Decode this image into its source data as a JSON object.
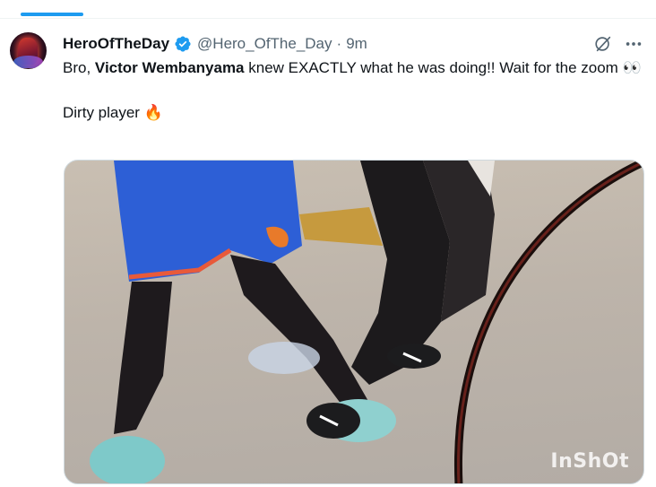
{
  "tweet": {
    "display_name": "HeroOfTheDay",
    "handle": "@Hero_OfThe_Day",
    "separator": "·",
    "time": "9m",
    "text_before_bold": "Bro, ",
    "text_bold": "Victor Wembanyama",
    "text_after_bold": " knew EXACTLY what he was doing!! Wait for the zoom 👀",
    "text_line2": "Dirty player 🔥",
    "media_watermark": "InShOt"
  },
  "icons": {
    "verified": "verified-badge-icon",
    "grok": "grok-icon",
    "more": "more-options-icon"
  },
  "colors": {
    "accent": "#1d9bf0",
    "text_primary": "#0f1419",
    "text_secondary": "#536471"
  }
}
